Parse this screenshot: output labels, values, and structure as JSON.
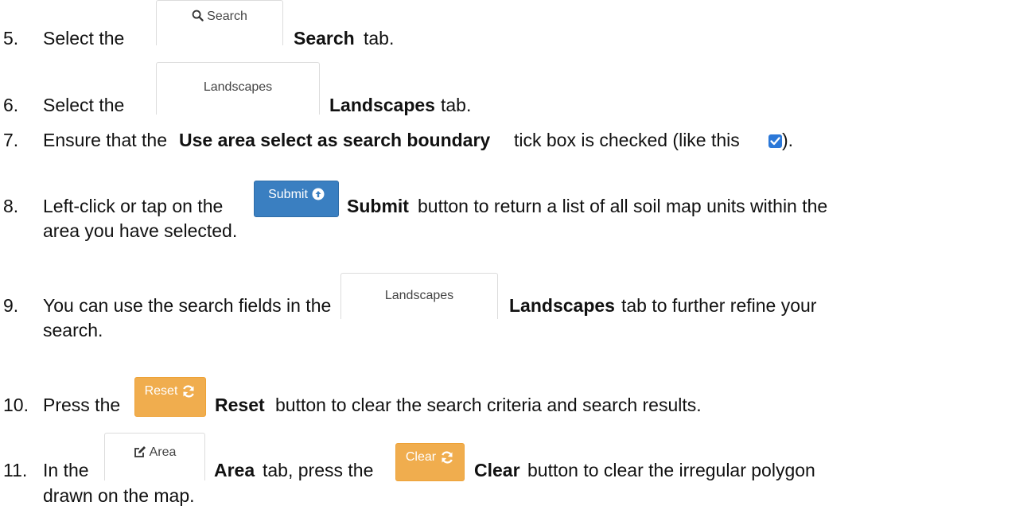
{
  "steps": [
    {
      "num": "5.",
      "pre": "Select the",
      "bold": "Search",
      "post": "tab.",
      "ui_label": "Search",
      "ui_icon": "search-icon"
    },
    {
      "num": "6.",
      "pre": "Select the",
      "bold": "Landscapes",
      "post": "tab.",
      "ui_label": "Landscapes"
    },
    {
      "num": "7.",
      "pre": "Ensure that the",
      "bold": "Use area select as search boundary",
      "post": "tick box is checked (like this",
      "post2": ")."
    },
    {
      "num": "8.",
      "pre": "Left-click or tap on the",
      "bold": "Submit",
      "post": "button to return a list of all soil map units within the",
      "line2": "area you have selected.",
      "ui_label": "Submit",
      "ui_icon": "arrow-up-circle-icon"
    },
    {
      "num": "9.",
      "pre": "You can use the search fields in the",
      "bold": "Landscapes",
      "post": "tab to further refine your",
      "line2": "search.",
      "ui_label": "Landscapes"
    },
    {
      "num": "10.",
      "pre": "Press the",
      "bold": "Reset",
      "post": "button to clear the search criteria and search results.",
      "ui_label": "Reset",
      "ui_icon": "refresh-icon"
    },
    {
      "num": "11.",
      "pre": "In the",
      "bold": "Area",
      "mid": "tab, press the",
      "bold2": "Clear",
      "post": "button to clear the irregular polygon",
      "line2": "drawn on the map.",
      "ui_label": "Area",
      "ui_icon": "edit-icon",
      "ui_label2": "Clear",
      "ui_icon2": "refresh-icon"
    }
  ],
  "colors": {
    "primary": "#3a7fc1",
    "warning": "#f0ad4e",
    "check": "#2b78d8"
  }
}
